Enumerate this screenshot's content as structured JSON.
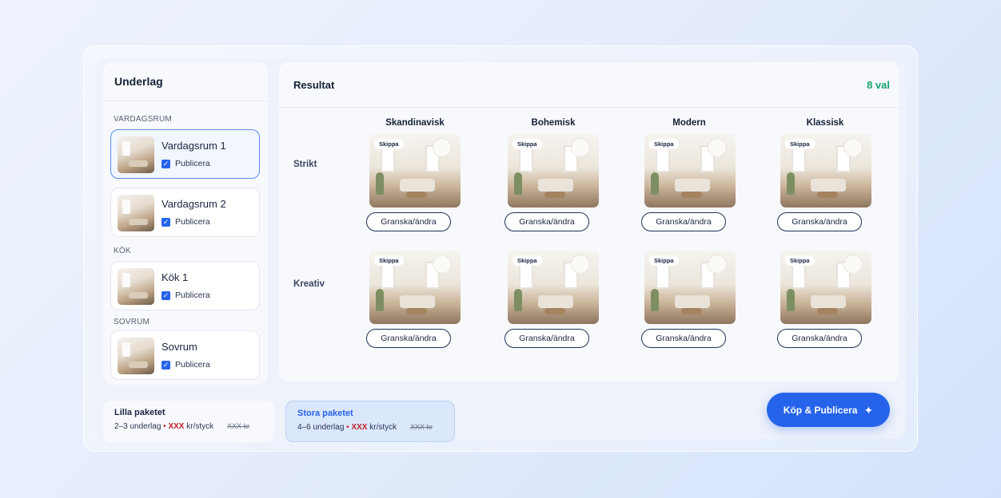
{
  "left": {
    "title": "Underlag",
    "sections": [
      {
        "label": "VARDAGSRUM"
      },
      {
        "label": "KÖK"
      },
      {
        "label": "SOVRUM"
      }
    ],
    "items": [
      {
        "name": "Vardagsrum 1",
        "publish": "Publicera"
      },
      {
        "name": "Vardagsrum 2",
        "publish": "Publicera"
      },
      {
        "name": "Kök 1",
        "publish": "Publicera"
      },
      {
        "name": "Sovrum",
        "publish": "Publicera"
      }
    ]
  },
  "right": {
    "title": "Resultat",
    "count": "8 val",
    "columns": [
      "Skandinavisk",
      "Bohemisk",
      "Modern",
      "Klassisk"
    ],
    "rows": [
      "Strikt",
      "Kreativ"
    ],
    "skip_label": "Skippa",
    "review_label": "Granska/ändra"
  },
  "packages": [
    {
      "title": "Lilla paketet",
      "range": "2–3 underlag",
      "sep": "•",
      "price": "XXX",
      "unit": "kr/styck",
      "old": "XXX kr"
    },
    {
      "title": "Stora paketet",
      "range": "4–6 underlag",
      "sep": "•",
      "price": "XXX",
      "unit": "kr/styck",
      "old": "XXX kr"
    }
  ],
  "buy_label": "Köp & Publicera",
  "colors": {
    "accent": "#2563eb",
    "count": "#14a36b",
    "price": "#c0212a"
  }
}
